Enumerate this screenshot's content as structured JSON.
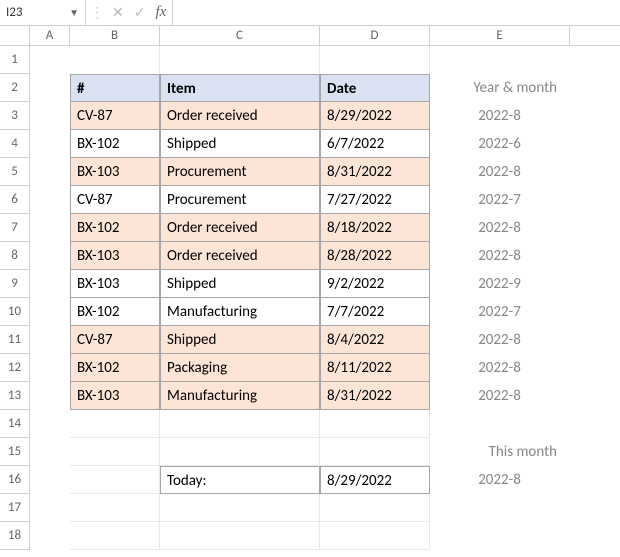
{
  "formula_bar": {
    "cell_ref": "I23",
    "formula": ""
  },
  "columns": [
    "A",
    "B",
    "C",
    "D",
    "E"
  ],
  "row_numbers": [
    "1",
    "2",
    "3",
    "4",
    "5",
    "6",
    "7",
    "8",
    "9",
    "10",
    "11",
    "12",
    "13",
    "14",
    "15",
    "16",
    "17",
    "18"
  ],
  "table": {
    "headers": {
      "id": "#",
      "item": "Item",
      "date": "Date"
    },
    "helper_header": "Year & month",
    "rows": [
      {
        "id": "CV-87",
        "item": "Order received",
        "date": "8/29/2022",
        "ym": "2022-8",
        "hl": true
      },
      {
        "id": "BX-102",
        "item": "Shipped",
        "date": "6/7/2022",
        "ym": "2022-6",
        "hl": false
      },
      {
        "id": "BX-103",
        "item": "Procurement",
        "date": "8/31/2022",
        "ym": "2022-8",
        "hl": true
      },
      {
        "id": "CV-87",
        "item": "Procurement",
        "date": "7/27/2022",
        "ym": "2022-7",
        "hl": false
      },
      {
        "id": "BX-102",
        "item": "Order received",
        "date": "8/18/2022",
        "ym": "2022-8",
        "hl": true
      },
      {
        "id": "BX-103",
        "item": "Order received",
        "date": "8/28/2022",
        "ym": "2022-8",
        "hl": true
      },
      {
        "id": "BX-103",
        "item": "Shipped",
        "date": "9/2/2022",
        "ym": "2022-9",
        "hl": false
      },
      {
        "id": "BX-102",
        "item": "Manufacturing",
        "date": "7/7/2022",
        "ym": "2022-7",
        "hl": false
      },
      {
        "id": "CV-87",
        "item": "Shipped",
        "date": "8/4/2022",
        "ym": "2022-8",
        "hl": true
      },
      {
        "id": "BX-102",
        "item": "Packaging",
        "date": "8/11/2022",
        "ym": "2022-8",
        "hl": true
      },
      {
        "id": "BX-103",
        "item": "Manufacturing",
        "date": "8/31/2022",
        "ym": "2022-8",
        "hl": true
      }
    ]
  },
  "today_section": {
    "header": "This month",
    "label": "Today:",
    "date": "8/29/2022",
    "ym": "2022-8"
  }
}
